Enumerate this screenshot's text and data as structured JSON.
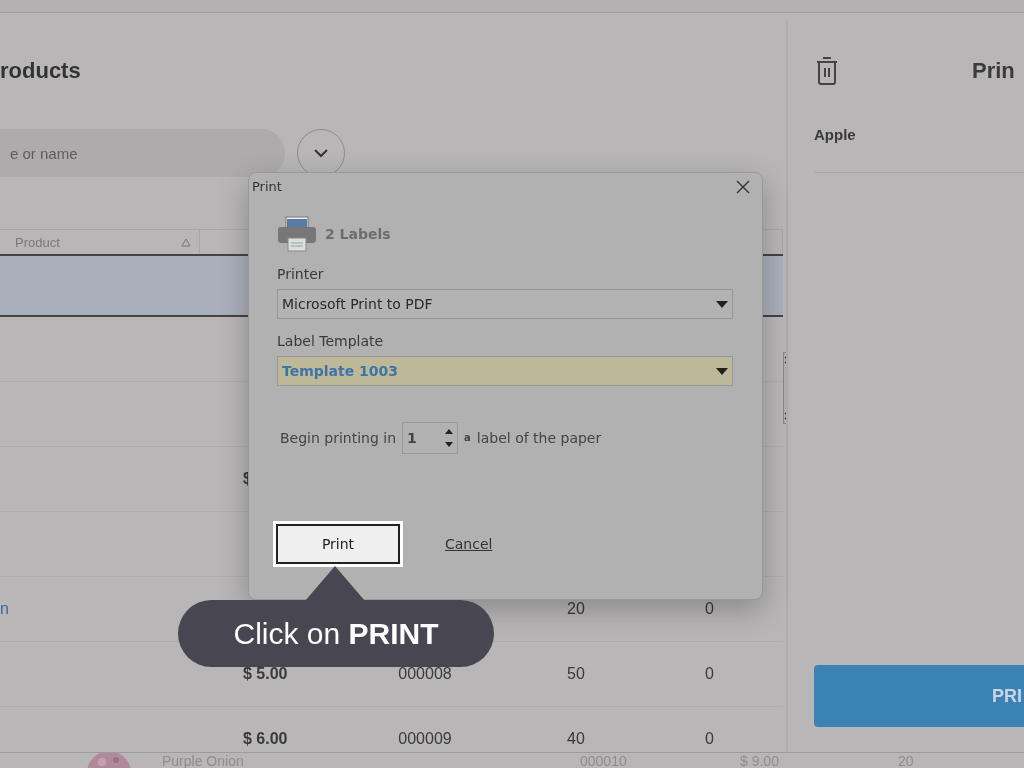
{
  "products_panel": {
    "title": "roducts",
    "search": {
      "placeholder": "e or name"
    },
    "columns": [
      {
        "label": "Product"
      }
    ],
    "rows": [
      {
        "selected": true
      },
      {
        "selected": false
      },
      {
        "selected": false
      },
      {
        "selected": false,
        "price": "$"
      },
      {
        "selected": false
      },
      {
        "selected": false,
        "name": "n",
        "qty": "20",
        "column_5": "0"
      },
      {
        "selected": false,
        "price": "$ 5.00",
        "code": "000008",
        "qty": "50",
        "column_5": "0"
      },
      {
        "selected": false,
        "price": "$ 6.00",
        "code": "000009",
        "qty": "40",
        "column_5": "0"
      }
    ],
    "bottom_row": {
      "name": "Purple Onion",
      "code": "000010",
      "price": "$ 9.00",
      "qty": "20"
    }
  },
  "right_panel": {
    "title": "Prin",
    "items": [
      "Apple"
    ],
    "print_button": "PRI"
  },
  "dialog": {
    "title": "Print",
    "count": "2 Labels",
    "printer": {
      "label": "Printer",
      "value": "Microsoft Print to PDF",
      "highlighted": false
    },
    "template": {
      "label": "Label Template",
      "value": "Template 1003",
      "highlighted": true
    },
    "start": {
      "before": "Begin printing in",
      "value": "1",
      "suffix": "a",
      "after": "label of the paper"
    },
    "buttons": [
      {
        "label": "Print",
        "kind": "primary",
        "focused": true
      },
      {
        "label": "Cancel",
        "kind": "link",
        "focused": false
      }
    ]
  },
  "callout": {
    "text": "Click on **PRINT**"
  }
}
